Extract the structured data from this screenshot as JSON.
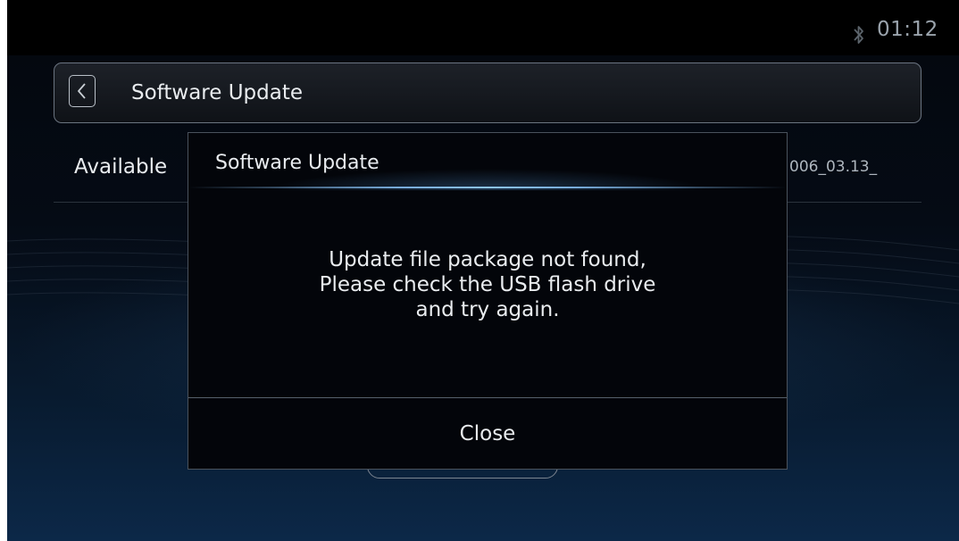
{
  "status_bar": {
    "bluetooth_icon": "bluetooth-icon",
    "time": "01:12"
  },
  "header": {
    "back_icon": "chevron-left-icon",
    "title": "Software Update"
  },
  "settings_row": {
    "label": "Available",
    "value": "006_03.13_"
  },
  "dialog": {
    "title": "Software Update",
    "message_lines": [
      "Update file package not found,",
      "Please check the USB flash drive",
      "and try again."
    ],
    "close_label": "Close"
  },
  "colors": {
    "background_top": "#000000",
    "background_bottom": "#0c2848",
    "accent_line": "#8cc3f0",
    "text": "#e9ecef"
  }
}
